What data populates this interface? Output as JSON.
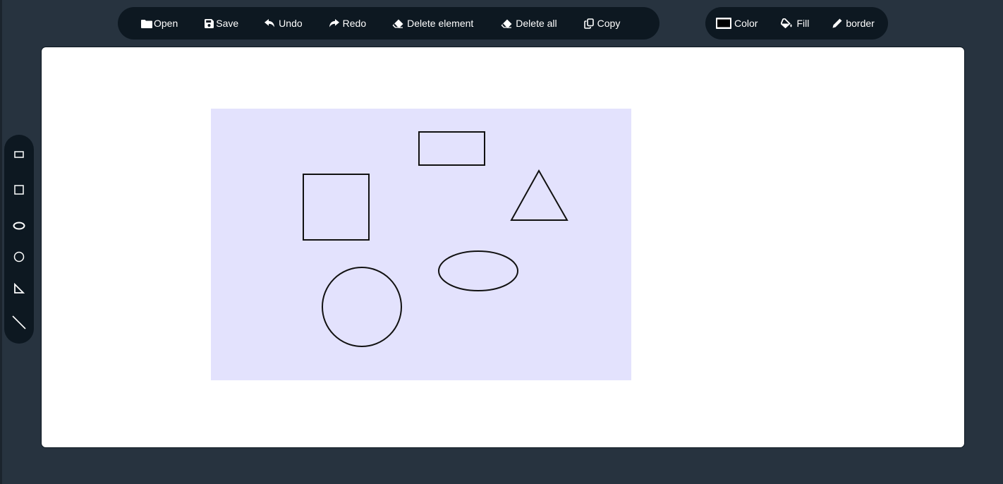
{
  "toolbar": {
    "open_label": "Open",
    "save_label": "Save",
    "undo_label": "Undo",
    "redo_label": "Redo",
    "delete_element_label": "Delete element",
    "delete_all_label": "Delete all",
    "copy_label": "Copy"
  },
  "style_toolbar": {
    "color_label": "Color",
    "fill_label": "Fill",
    "border_label": "border"
  },
  "icons": {
    "open": "folder-icon",
    "save": "floppy-disk-icon",
    "undo": "undo-arrow-icon",
    "redo": "redo-arrow-icon",
    "delete_element": "eraser-icon",
    "delete_all": "eraser-icon",
    "copy": "copy-icon",
    "color": "color-swatch-icon",
    "fill": "paint-bucket-icon",
    "border": "pencil-icon"
  },
  "shape_tools": [
    {
      "name": "rectangle",
      "icon": "rectangle-icon"
    },
    {
      "name": "square",
      "icon": "square-icon"
    },
    {
      "name": "ellipse",
      "icon": "ellipse-icon"
    },
    {
      "name": "circle",
      "icon": "circle-icon"
    },
    {
      "name": "triangle",
      "icon": "right-triangle-icon"
    },
    {
      "name": "line",
      "icon": "line-icon"
    }
  ],
  "canvas": {
    "shapes": [
      "rectangle",
      "square",
      "triangle",
      "ellipse",
      "circle"
    ]
  },
  "colors": {
    "background": "#27333f",
    "toolbar": "#0d1821",
    "toolbar_text": "#ffffff",
    "board": "#ffffff",
    "drawing_area": "#e3e2fd",
    "shape_stroke": "#111111"
  }
}
